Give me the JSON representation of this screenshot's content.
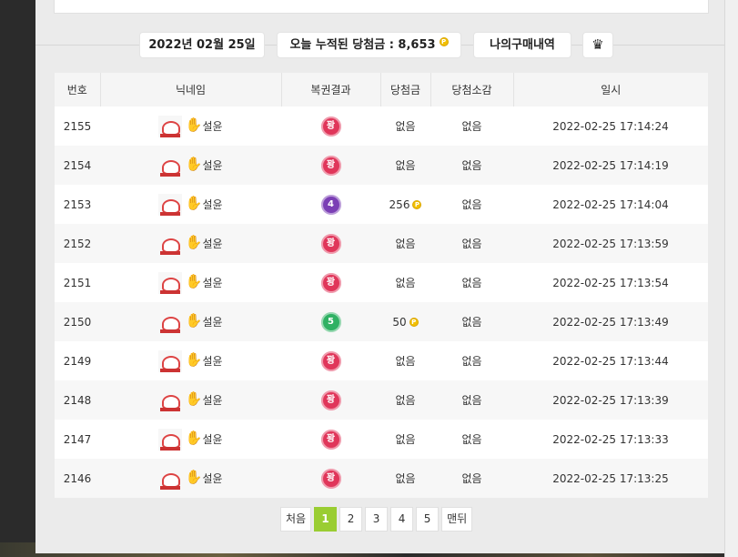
{
  "header": {
    "date": "2022년 02월 25일",
    "total_label": "오늘 누적된 당첨금 : 8,653",
    "history_button": "나의구매내역",
    "crown_icon": "crown-icon"
  },
  "table": {
    "columns": [
      "번호",
      "닉네임",
      "복권결과",
      "당첨금",
      "당첨소감",
      "일시"
    ],
    "rows": [
      {
        "no": "2155",
        "nick": "설윤",
        "result": "꽝",
        "result_color": "#e0365a",
        "prize": "없음",
        "prize_coin": false,
        "comment": "없음",
        "time": "2022-02-25 17:14:24"
      },
      {
        "no": "2154",
        "nick": "설윤",
        "result": "꽝",
        "result_color": "#e0365a",
        "prize": "없음",
        "prize_coin": false,
        "comment": "없음",
        "time": "2022-02-25 17:14:19"
      },
      {
        "no": "2153",
        "nick": "설윤",
        "result": "4",
        "result_color": "#7b3fb5",
        "prize": "256",
        "prize_coin": true,
        "comment": "없음",
        "time": "2022-02-25 17:14:04"
      },
      {
        "no": "2152",
        "nick": "설윤",
        "result": "꽝",
        "result_color": "#e0365a",
        "prize": "없음",
        "prize_coin": false,
        "comment": "없음",
        "time": "2022-02-25 17:13:59"
      },
      {
        "no": "2151",
        "nick": "설윤",
        "result": "꽝",
        "result_color": "#e0365a",
        "prize": "없음",
        "prize_coin": false,
        "comment": "없음",
        "time": "2022-02-25 17:13:54"
      },
      {
        "no": "2150",
        "nick": "설윤",
        "result": "5",
        "result_color": "#2fb163",
        "prize": "50",
        "prize_coin": true,
        "comment": "없음",
        "time": "2022-02-25 17:13:49"
      },
      {
        "no": "2149",
        "nick": "설윤",
        "result": "꽝",
        "result_color": "#e0365a",
        "prize": "없음",
        "prize_coin": false,
        "comment": "없음",
        "time": "2022-02-25 17:13:44"
      },
      {
        "no": "2148",
        "nick": "설윤",
        "result": "꽝",
        "result_color": "#e0365a",
        "prize": "없음",
        "prize_coin": false,
        "comment": "없음",
        "time": "2022-02-25 17:13:39"
      },
      {
        "no": "2147",
        "nick": "설윤",
        "result": "꽝",
        "result_color": "#e0365a",
        "prize": "없음",
        "prize_coin": false,
        "comment": "없음",
        "time": "2022-02-25 17:13:33"
      },
      {
        "no": "2146",
        "nick": "설윤",
        "result": "꽝",
        "result_color": "#e0365a",
        "prize": "없음",
        "prize_coin": false,
        "comment": "없음",
        "time": "2022-02-25 17:13:25"
      }
    ]
  },
  "pagination": {
    "first": "처음",
    "pages": [
      "1",
      "2",
      "3",
      "4",
      "5"
    ],
    "active": "1",
    "last": "맨뒤"
  },
  "colors": {
    "active_page": "#9acd32",
    "coin": "#f2c000"
  }
}
